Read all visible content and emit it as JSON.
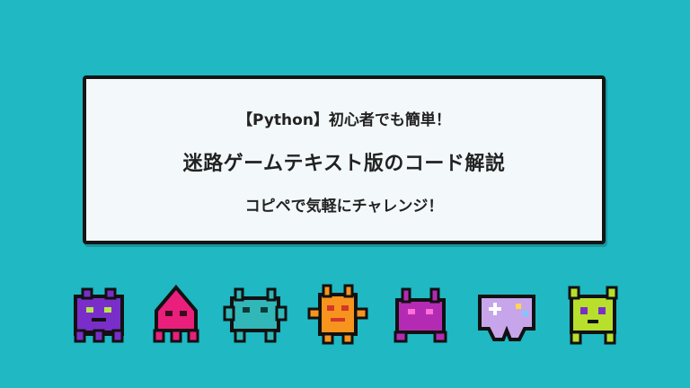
{
  "card": {
    "line1": "【Python】初心者でも簡単！",
    "line2": "迷路ゲームテキスト版のコード解説",
    "line3": "コピペで気軽にチャレンジ！"
  },
  "sprites": [
    {
      "name": "purple-octopus-invader-icon",
      "color": "#7a2ec9"
    },
    {
      "name": "pink-squid-invader-icon",
      "color": "#ea1f7c"
    },
    {
      "name": "teal-crab-invader-icon",
      "color": "#32b7b9"
    },
    {
      "name": "orange-monster-icon",
      "color": "#f7941e"
    },
    {
      "name": "magenta-crab-invader-icon",
      "color": "#b42bb3"
    },
    {
      "name": "lavender-gamepad-icon",
      "color": "#c6a5ea"
    },
    {
      "name": "lime-invader-icon",
      "color": "#b8df2c"
    }
  ]
}
